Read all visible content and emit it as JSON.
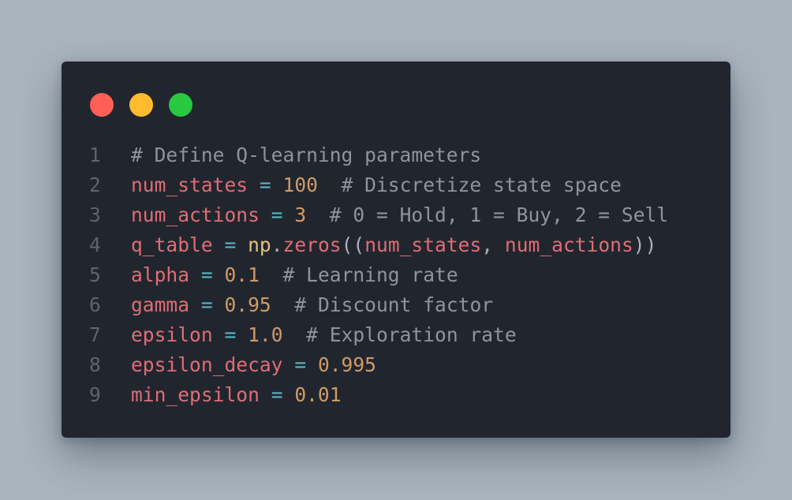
{
  "window": {
    "controls": [
      {
        "name": "close",
        "color": "#ff5f57"
      },
      {
        "name": "minimize",
        "color": "#febc2e"
      },
      {
        "name": "maximize",
        "color": "#28c840"
      }
    ]
  },
  "colors": {
    "background": "#a9b4be",
    "editor": "#21262e",
    "comment": "#8d949e",
    "variable": "#e06c75",
    "operator": "#56b6c2",
    "number": "#d19a66",
    "module": "#e5c07b",
    "line_number": "#5c6470"
  },
  "code": {
    "lines": [
      {
        "num": "1",
        "tokens": [
          {
            "t": "comment",
            "v": "# Define Q-learning parameters"
          }
        ]
      },
      {
        "num": "2",
        "tokens": [
          {
            "t": "var",
            "v": "num_states"
          },
          {
            "t": "text",
            "v": " "
          },
          {
            "t": "op",
            "v": "="
          },
          {
            "t": "text",
            "v": " "
          },
          {
            "t": "num",
            "v": "100"
          },
          {
            "t": "text",
            "v": "  "
          },
          {
            "t": "comment",
            "v": "# Discretize state space"
          }
        ]
      },
      {
        "num": "3",
        "tokens": [
          {
            "t": "var",
            "v": "num_actions"
          },
          {
            "t": "text",
            "v": " "
          },
          {
            "t": "op",
            "v": "="
          },
          {
            "t": "text",
            "v": " "
          },
          {
            "t": "num",
            "v": "3"
          },
          {
            "t": "text",
            "v": "  "
          },
          {
            "t": "comment",
            "v": "# 0 = Hold, 1 = Buy, 2 = Sell"
          }
        ]
      },
      {
        "num": "4",
        "tokens": [
          {
            "t": "var",
            "v": "q_table"
          },
          {
            "t": "text",
            "v": " "
          },
          {
            "t": "op",
            "v": "="
          },
          {
            "t": "text",
            "v": " "
          },
          {
            "t": "mod",
            "v": "np"
          },
          {
            "t": "punc",
            "v": "."
          },
          {
            "t": "var",
            "v": "zeros"
          },
          {
            "t": "punc",
            "v": "(("
          },
          {
            "t": "var",
            "v": "num_states"
          },
          {
            "t": "punc",
            "v": ", "
          },
          {
            "t": "var",
            "v": "num_actions"
          },
          {
            "t": "punc",
            "v": "))"
          }
        ]
      },
      {
        "num": "5",
        "tokens": [
          {
            "t": "var",
            "v": "alpha"
          },
          {
            "t": "text",
            "v": " "
          },
          {
            "t": "op",
            "v": "="
          },
          {
            "t": "text",
            "v": " "
          },
          {
            "t": "num",
            "v": "0.1"
          },
          {
            "t": "text",
            "v": "  "
          },
          {
            "t": "comment",
            "v": "# Learning rate"
          }
        ]
      },
      {
        "num": "6",
        "tokens": [
          {
            "t": "var",
            "v": "gamma"
          },
          {
            "t": "text",
            "v": " "
          },
          {
            "t": "op",
            "v": "="
          },
          {
            "t": "text",
            "v": " "
          },
          {
            "t": "num",
            "v": "0.95"
          },
          {
            "t": "text",
            "v": "  "
          },
          {
            "t": "comment",
            "v": "# Discount factor"
          }
        ]
      },
      {
        "num": "7",
        "tokens": [
          {
            "t": "var",
            "v": "epsilon"
          },
          {
            "t": "text",
            "v": " "
          },
          {
            "t": "op",
            "v": "="
          },
          {
            "t": "text",
            "v": " "
          },
          {
            "t": "num",
            "v": "1.0"
          },
          {
            "t": "text",
            "v": "  "
          },
          {
            "t": "comment",
            "v": "# Exploration rate"
          }
        ]
      },
      {
        "num": "8",
        "tokens": [
          {
            "t": "var",
            "v": "epsilon_decay"
          },
          {
            "t": "text",
            "v": " "
          },
          {
            "t": "op",
            "v": "="
          },
          {
            "t": "text",
            "v": " "
          },
          {
            "t": "num",
            "v": "0.995"
          }
        ]
      },
      {
        "num": "9",
        "tokens": [
          {
            "t": "var",
            "v": "min_epsilon"
          },
          {
            "t": "text",
            "v": " "
          },
          {
            "t": "op",
            "v": "="
          },
          {
            "t": "text",
            "v": " "
          },
          {
            "t": "num",
            "v": "0.01"
          }
        ]
      }
    ]
  }
}
